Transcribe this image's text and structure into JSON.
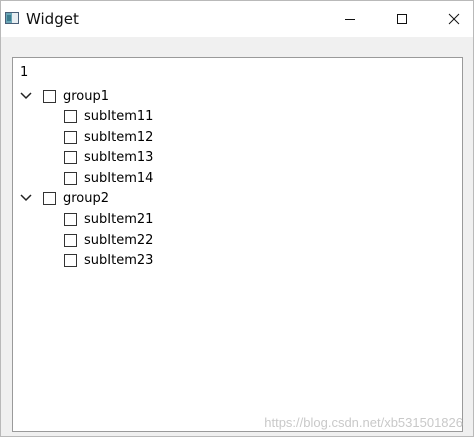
{
  "window": {
    "title": "Widget",
    "icon": "app-window-icon"
  },
  "tree": {
    "header": "1",
    "groups": [
      {
        "label": "group1",
        "expanded": true,
        "checked": false,
        "children": [
          {
            "label": "subItem11",
            "checked": false
          },
          {
            "label": "subItem12",
            "checked": false
          },
          {
            "label": "subItem13",
            "checked": false
          },
          {
            "label": "subItem14",
            "checked": false
          }
        ]
      },
      {
        "label": "group2",
        "expanded": true,
        "checked": false,
        "children": [
          {
            "label": "subItem21",
            "checked": false
          },
          {
            "label": "subItem22",
            "checked": false
          },
          {
            "label": "subItem23",
            "checked": false
          }
        ]
      }
    ]
  },
  "watermark": "https://blog.csdn.net/xb531501826"
}
